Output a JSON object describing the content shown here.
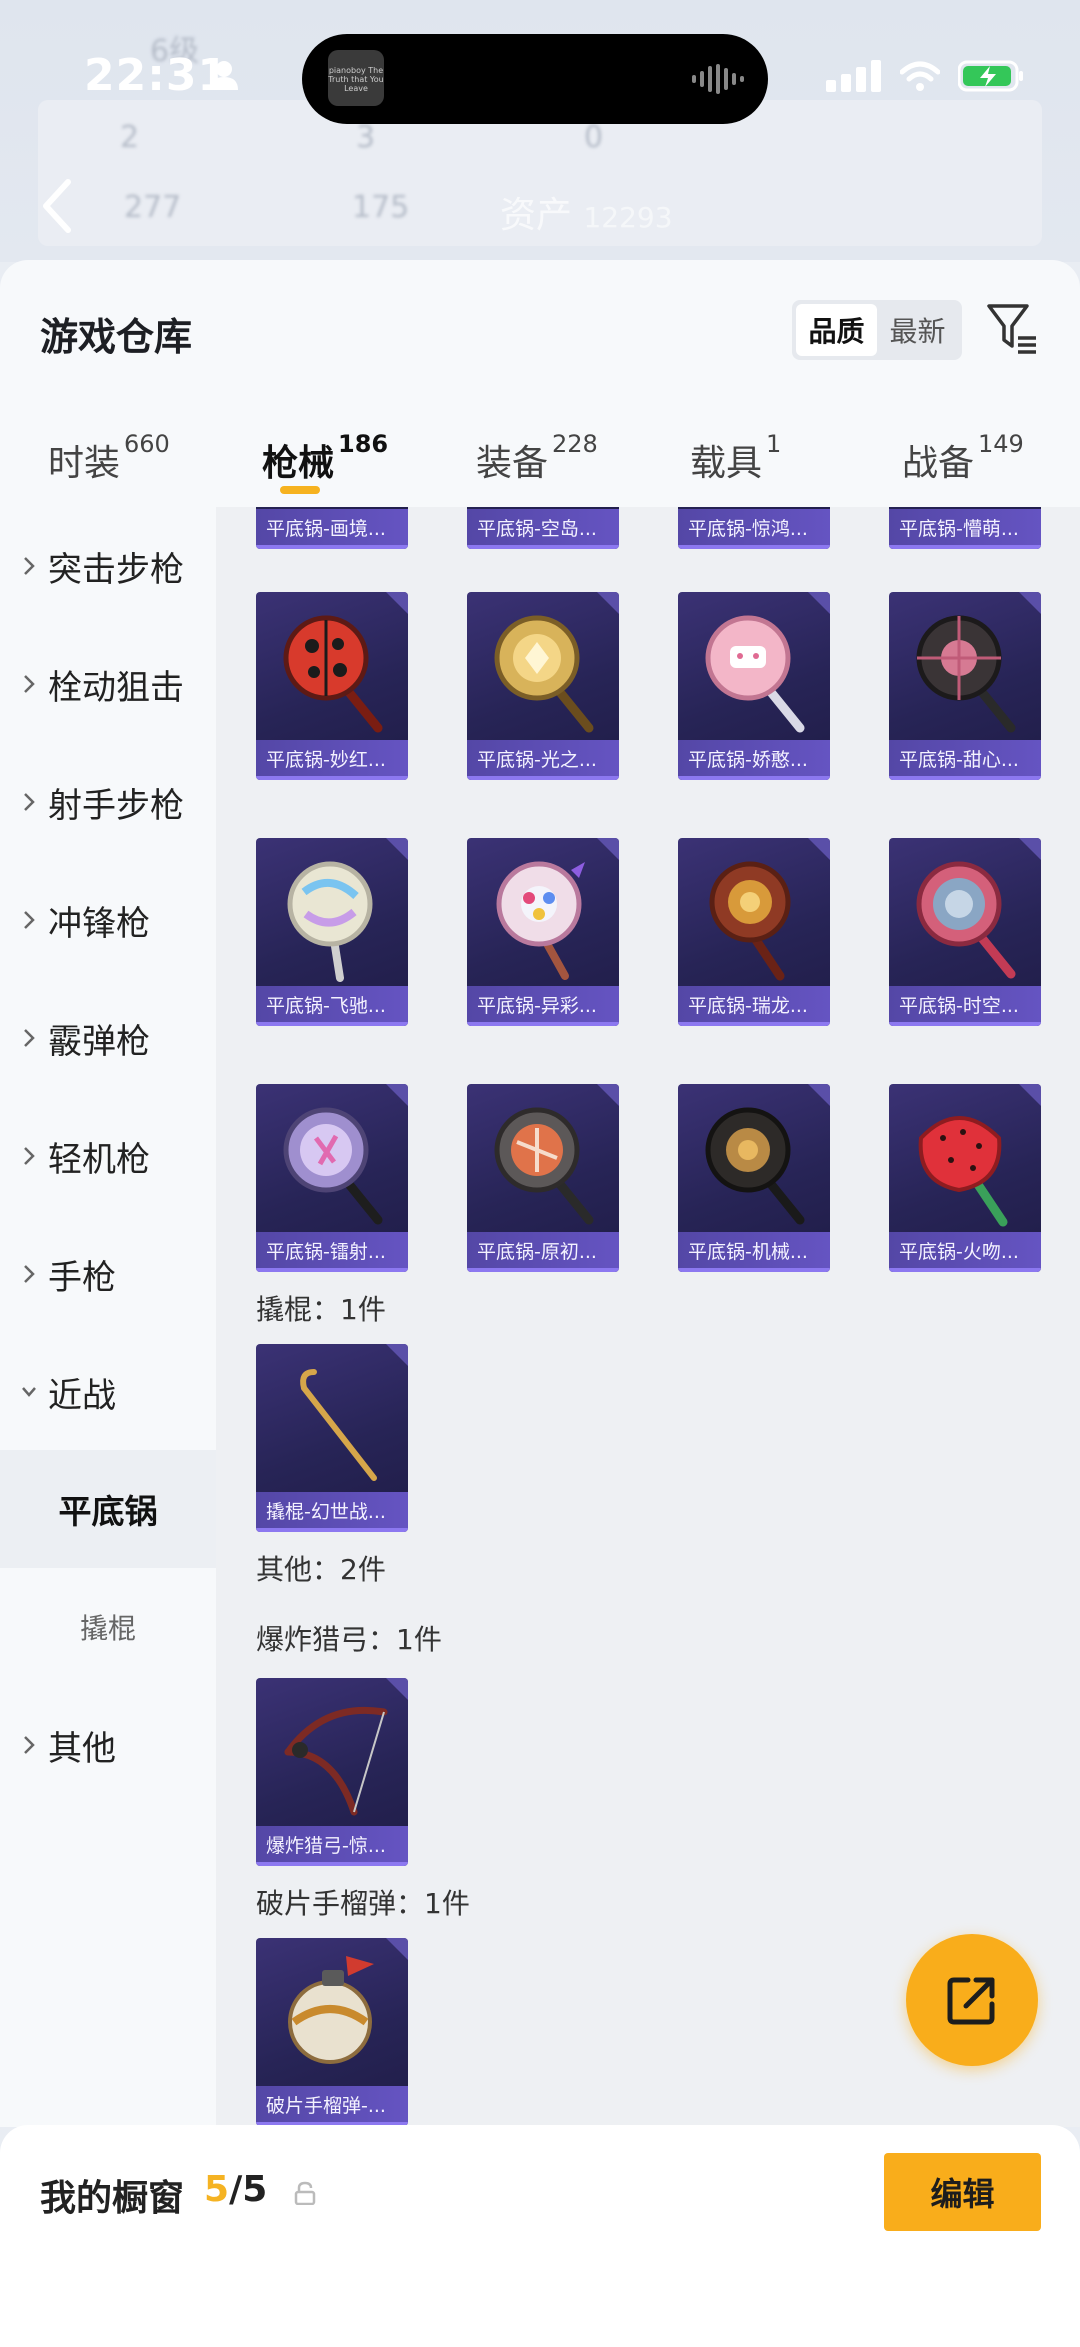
{
  "status_bar": {
    "time": "22:31"
  },
  "background": {
    "level": "6级",
    "asset_label": "资产",
    "asset_value": "12293",
    "stat_a": "2",
    "stat_b": "3",
    "stat_c": "0",
    "stat_d": "277",
    "stat_e": "175"
  },
  "island": {
    "thumb_text": "pianoboy The Truth that You Leave"
  },
  "panel": {
    "title": "游戏仓库"
  },
  "sort": {
    "quality": "品质",
    "newest": "最新"
  },
  "tabs": [
    {
      "label": "时装",
      "count": "660"
    },
    {
      "label": "枪械",
      "count": "186"
    },
    {
      "label": "装备",
      "count": "228"
    },
    {
      "label": "载具",
      "count": "1"
    },
    {
      "label": "战备",
      "count": "149"
    }
  ],
  "sidebar": {
    "items": [
      {
        "label": "突击步枪"
      },
      {
        "label": "栓动狙击"
      },
      {
        "label": "射手步枪"
      },
      {
        "label": "冲锋枪"
      },
      {
        "label": "霰弹枪"
      },
      {
        "label": "轻机枪"
      },
      {
        "label": "手枪"
      },
      {
        "label": "近战"
      },
      {
        "label": "平底锅"
      },
      {
        "label": "撬棍"
      },
      {
        "label": "其他"
      }
    ]
  },
  "content": {
    "top_row": [
      "平底锅-画境...",
      "平底锅-空岛...",
      "平底锅-惊鸿...",
      "平底锅-懵萌..."
    ],
    "row1": [
      "平底锅-妙红...",
      "平底锅-光之...",
      "平底锅-娇憨...",
      "平底锅-甜心..."
    ],
    "row2": [
      "平底锅-飞驰...",
      "平底锅-异彩...",
      "平底锅-瑞龙...",
      "平底锅-时空..."
    ],
    "row3": [
      "平底锅-镭射...",
      "平底锅-原初...",
      "平底锅-机械...",
      "平底锅-火吻..."
    ],
    "crowbar_section": "撬棍：1件",
    "crowbar_item": "撬棍-幻世战...",
    "other_section": "其他：2件",
    "bow_section": "爆炸猎弓：1件",
    "bow_item": "爆炸猎弓-惊...",
    "grenade_section": "破片手榴弹：1件",
    "grenade_item": "破片手榴弹-..."
  },
  "bottom_bar": {
    "title": "我的橱窗",
    "count_current": "5",
    "count_total": "/5",
    "edit_label": "编辑"
  },
  "colors": {
    "accent": "#f9ad1b",
    "item_bg": "#2a2660",
    "item_label_bg": "#5a4ab0"
  }
}
